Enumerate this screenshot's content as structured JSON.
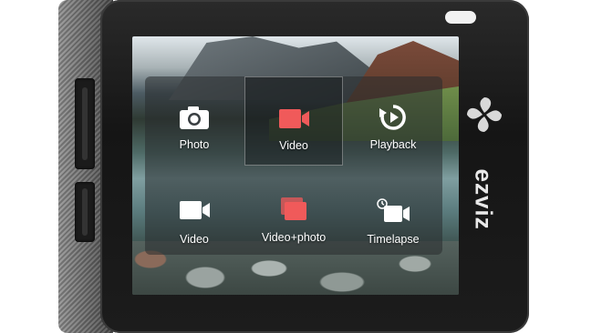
{
  "camera": {
    "brand": "ezviz",
    "accent_color": "#f05a5a"
  },
  "menu": {
    "selected": "Video",
    "items": [
      {
        "label": "Photo",
        "icon": "camera-icon"
      },
      {
        "label": "Video",
        "icon": "video-camera-icon"
      },
      {
        "label": "Playback",
        "icon": "playback-icon"
      },
      {
        "label": "Video",
        "icon": "video-camera-icon"
      },
      {
        "label": "Video+photo",
        "icon": "stacked-frames-icon"
      },
      {
        "label": "Timelapse",
        "icon": "timelapse-icon"
      }
    ]
  }
}
